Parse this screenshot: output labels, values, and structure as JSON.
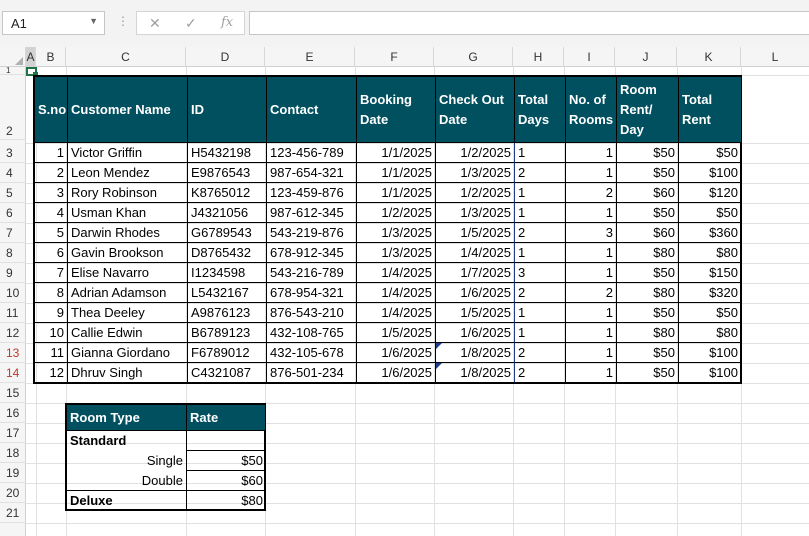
{
  "namebox": {
    "value": "A1"
  },
  "formula_bar": {
    "cancel": "✕",
    "enter": "✓",
    "fx": "fx",
    "value": ""
  },
  "columns": [
    "A",
    "B",
    "C",
    "D",
    "E",
    "F",
    "G",
    "H",
    "I",
    "J",
    "K",
    "L"
  ],
  "rows": [
    "1",
    "2",
    "3",
    "4",
    "5",
    "6",
    "7",
    "8",
    "9",
    "10",
    "11",
    "12",
    "13",
    "14",
    "15",
    "16",
    "17",
    "18",
    "19",
    "20",
    "21"
  ],
  "main_table": {
    "headers": [
      "S.no",
      "Customer Name",
      "ID",
      "Contact",
      "Booking Date",
      "Check Out Date",
      "Total Days",
      "No. of Rooms",
      "Room Rent/ Day",
      "Total Rent"
    ],
    "rows": [
      [
        "1",
        "Victor Griffin",
        "H5432198",
        "123-456-789",
        "1/1/2025",
        "1/2/2025",
        "1",
        "1",
        "$50",
        "$50"
      ],
      [
        "2",
        "Leon Mendez",
        "E9876543",
        "987-654-321",
        "1/1/2025",
        "1/3/2025",
        "2",
        "1",
        "$50",
        "$100"
      ],
      [
        "3",
        "Rory Robinson",
        "K8765012",
        "123-459-876",
        "1/1/2025",
        "1/2/2025",
        "1",
        "2",
        "$60",
        "$120"
      ],
      [
        "4",
        "Usman Khan",
        "J4321056",
        "987-612-345",
        "1/2/2025",
        "1/3/2025",
        "1",
        "1",
        "$50",
        "$50"
      ],
      [
        "5",
        "Darwin Rhodes",
        "G6789543",
        "543-219-876",
        "1/3/2025",
        "1/5/2025",
        "2",
        "3",
        "$60",
        "$360"
      ],
      [
        "6",
        "Gavin Brookson",
        "D8765432",
        "678-912-345",
        "1/3/2025",
        "1/4/2025",
        "1",
        "1",
        "$80",
        "$80"
      ],
      [
        "7",
        "Elise Navarro",
        "I1234598",
        "543-216-789",
        "1/4/2025",
        "1/7/2025",
        "3",
        "1",
        "$50",
        "$150"
      ],
      [
        "8",
        "Adrian Adamson",
        "L5432167",
        "678-954-321",
        "1/4/2025",
        "1/6/2025",
        "2",
        "2",
        "$80",
        "$320"
      ],
      [
        "9",
        "Thea Deeley",
        "A9876123",
        "876-543-210",
        "1/4/2025",
        "1/5/2025",
        "1",
        "1",
        "$50",
        "$50"
      ],
      [
        "10",
        "Callie Edwin",
        "B6789123",
        "432-108-765",
        "1/5/2025",
        "1/6/2025",
        "1",
        "1",
        "$80",
        "$80"
      ],
      [
        "11",
        "Gianna Giordano",
        "F6789012",
        "432-105-678",
        "1/6/2025",
        "1/8/2025",
        "2",
        "1",
        "$50",
        "$100"
      ],
      [
        "12",
        "Dhruv Singh",
        "C4321087",
        "876-501-234",
        "1/6/2025",
        "1/8/2025",
        "2",
        "1",
        "$50",
        "$100"
      ]
    ]
  },
  "rate_table": {
    "headers": [
      "Room Type",
      "Rate"
    ],
    "rows": [
      [
        "Standard",
        ""
      ],
      [
        "Single",
        "$50"
      ],
      [
        "Double",
        "$60"
      ],
      [
        "Deluxe",
        "$80"
      ]
    ]
  },
  "colors": {
    "header_fill": "#00505f",
    "header_text": "#ffffff",
    "selected_cell": "#217346"
  }
}
